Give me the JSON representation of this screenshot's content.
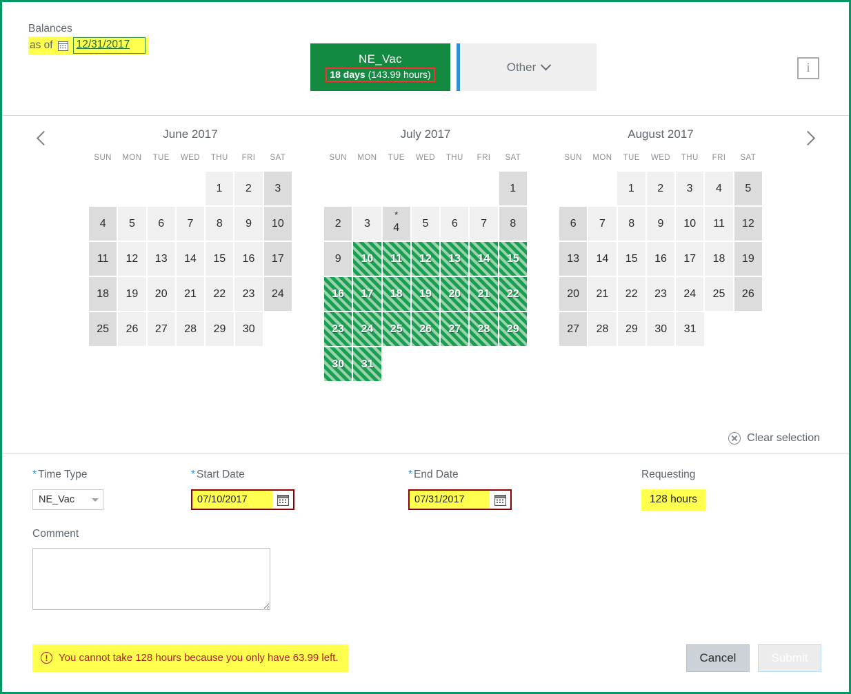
{
  "header": {
    "balances_title": "Balances",
    "as_of_label": "as of",
    "as_of_date": "12/31/2017",
    "calendar_icon": "calendar-icon",
    "info_icon": "i",
    "tabs": [
      {
        "id": "ne-vac",
        "title": "NE_Vac",
        "days": "18 days",
        "hours": "(143.99 hours)",
        "active": true,
        "color": "#138a3f"
      },
      {
        "id": "other",
        "label": "Other",
        "active": false,
        "accent": "#2f8fd8"
      }
    ]
  },
  "calendar": {
    "prev_label": "<",
    "next_label": ">",
    "dow": [
      "SUN",
      "MON",
      "TUE",
      "WED",
      "THU",
      "FRI",
      "SAT"
    ],
    "clear_label": "Clear selection",
    "months": [
      {
        "title": "June 2017",
        "lead_blanks": 4,
        "days": [
          {
            "n": 1,
            "type": "weekday"
          },
          {
            "n": 2,
            "type": "weekday"
          },
          {
            "n": 3,
            "type": "weekend"
          },
          {
            "n": 4,
            "type": "weekend"
          },
          {
            "n": 5,
            "type": "weekday"
          },
          {
            "n": 6,
            "type": "weekday"
          },
          {
            "n": 7,
            "type": "weekday"
          },
          {
            "n": 8,
            "type": "weekday"
          },
          {
            "n": 9,
            "type": "weekday"
          },
          {
            "n": 10,
            "type": "weekend"
          },
          {
            "n": 11,
            "type": "weekend"
          },
          {
            "n": 12,
            "type": "weekday"
          },
          {
            "n": 13,
            "type": "weekday"
          },
          {
            "n": 14,
            "type": "weekday"
          },
          {
            "n": 15,
            "type": "weekday"
          },
          {
            "n": 16,
            "type": "weekday"
          },
          {
            "n": 17,
            "type": "weekend"
          },
          {
            "n": 18,
            "type": "weekend"
          },
          {
            "n": 19,
            "type": "weekday"
          },
          {
            "n": 20,
            "type": "weekday"
          },
          {
            "n": 21,
            "type": "weekday"
          },
          {
            "n": 22,
            "type": "weekday"
          },
          {
            "n": 23,
            "type": "weekday"
          },
          {
            "n": 24,
            "type": "weekend"
          },
          {
            "n": 25,
            "type": "weekend"
          },
          {
            "n": 26,
            "type": "weekday"
          },
          {
            "n": 27,
            "type": "weekday"
          },
          {
            "n": 28,
            "type": "weekday"
          },
          {
            "n": 29,
            "type": "weekday"
          },
          {
            "n": 30,
            "type": "weekday"
          }
        ]
      },
      {
        "title": "July 2017",
        "lead_blanks": 6,
        "days": [
          {
            "n": 1,
            "type": "weekend"
          },
          {
            "n": 2,
            "type": "weekend"
          },
          {
            "n": 3,
            "type": "weekday"
          },
          {
            "n": 4,
            "type": "weekend",
            "star": "*"
          },
          {
            "n": 5,
            "type": "weekday"
          },
          {
            "n": 6,
            "type": "weekday"
          },
          {
            "n": 7,
            "type": "weekday"
          },
          {
            "n": 8,
            "type": "weekend"
          },
          {
            "n": 9,
            "type": "weekend"
          },
          {
            "n": 10,
            "type": "selected"
          },
          {
            "n": 11,
            "type": "selected"
          },
          {
            "n": 12,
            "type": "selected"
          },
          {
            "n": 13,
            "type": "selected"
          },
          {
            "n": 14,
            "type": "selected"
          },
          {
            "n": 15,
            "type": "selected"
          },
          {
            "n": 16,
            "type": "selected"
          },
          {
            "n": 17,
            "type": "selected"
          },
          {
            "n": 18,
            "type": "selected"
          },
          {
            "n": 19,
            "type": "selected"
          },
          {
            "n": 20,
            "type": "selected"
          },
          {
            "n": 21,
            "type": "selected"
          },
          {
            "n": 22,
            "type": "selected"
          },
          {
            "n": 23,
            "type": "selected"
          },
          {
            "n": 24,
            "type": "selected"
          },
          {
            "n": 25,
            "type": "selected"
          },
          {
            "n": 26,
            "type": "selected"
          },
          {
            "n": 27,
            "type": "selected"
          },
          {
            "n": 28,
            "type": "selected"
          },
          {
            "n": 29,
            "type": "selected"
          },
          {
            "n": 30,
            "type": "selected"
          },
          {
            "n": 31,
            "type": "selected"
          }
        ]
      },
      {
        "title": "August 2017",
        "lead_blanks": 2,
        "days": [
          {
            "n": 1,
            "type": "weekday"
          },
          {
            "n": 2,
            "type": "weekday"
          },
          {
            "n": 3,
            "type": "weekday"
          },
          {
            "n": 4,
            "type": "weekday"
          },
          {
            "n": 5,
            "type": "weekend"
          },
          {
            "n": 6,
            "type": "weekend"
          },
          {
            "n": 7,
            "type": "weekday"
          },
          {
            "n": 8,
            "type": "weekday"
          },
          {
            "n": 9,
            "type": "weekday"
          },
          {
            "n": 10,
            "type": "weekday"
          },
          {
            "n": 11,
            "type": "weekday"
          },
          {
            "n": 12,
            "type": "weekend"
          },
          {
            "n": 13,
            "type": "weekend"
          },
          {
            "n": 14,
            "type": "weekday"
          },
          {
            "n": 15,
            "type": "weekday"
          },
          {
            "n": 16,
            "type": "weekday"
          },
          {
            "n": 17,
            "type": "weekday"
          },
          {
            "n": 18,
            "type": "weekday"
          },
          {
            "n": 19,
            "type": "weekend"
          },
          {
            "n": 20,
            "type": "weekend"
          },
          {
            "n": 21,
            "type": "weekday"
          },
          {
            "n": 22,
            "type": "weekday"
          },
          {
            "n": 23,
            "type": "weekday"
          },
          {
            "n": 24,
            "type": "weekday"
          },
          {
            "n": 25,
            "type": "weekday"
          },
          {
            "n": 26,
            "type": "weekend"
          },
          {
            "n": 27,
            "type": "weekend"
          },
          {
            "n": 28,
            "type": "weekday"
          },
          {
            "n": 29,
            "type": "weekday"
          },
          {
            "n": 30,
            "type": "weekday"
          },
          {
            "n": 31,
            "type": "weekday"
          }
        ]
      }
    ]
  },
  "form": {
    "time_type": {
      "label": "Time Type",
      "required": "*",
      "value": "NE_Vac"
    },
    "start_date": {
      "label": "Start Date",
      "required": "*",
      "value": "07/10/2017"
    },
    "end_date": {
      "label": "End Date",
      "required": "*",
      "value": "07/31/2017"
    },
    "requesting": {
      "label": "Requesting",
      "value": "128 hours"
    },
    "comment": {
      "label": "Comment",
      "value": "",
      "placeholder": ""
    },
    "error": {
      "icon": "!",
      "message": "You cannot take 128 hours because you only have 63.99 left."
    },
    "buttons": {
      "cancel": "Cancel",
      "submit": "Submit"
    }
  }
}
